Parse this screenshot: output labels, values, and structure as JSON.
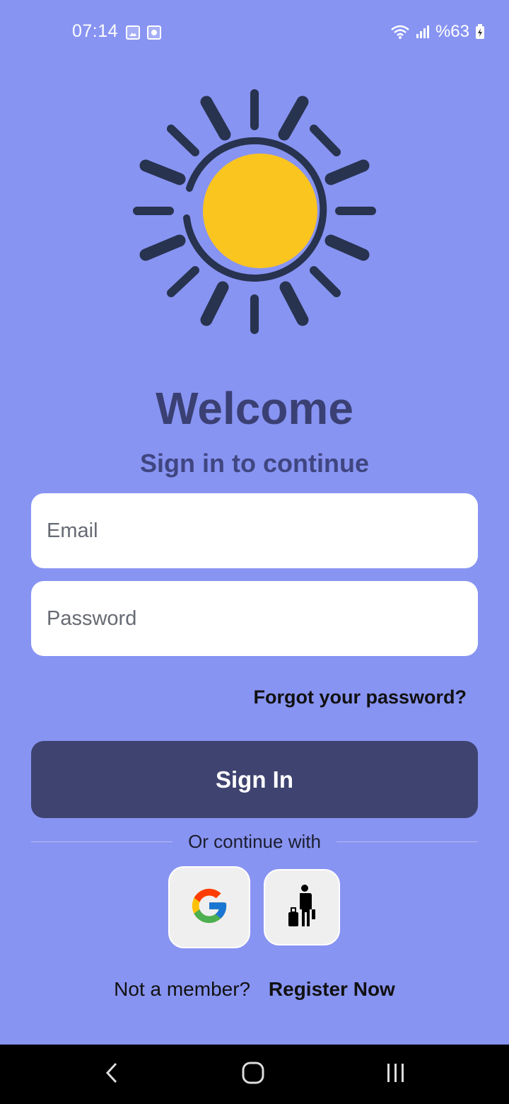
{
  "status_bar": {
    "time": "07:14",
    "battery": "%63",
    "icons": [
      "gallery-icon",
      "screen-record-icon",
      "wifi-icon",
      "signal-icon",
      "battery-icon"
    ]
  },
  "logo": {
    "icon": "sun-logo-icon",
    "colors": {
      "rays": "#27334f",
      "sun": "#fbc520"
    }
  },
  "header": {
    "title": "Welcome",
    "subtitle": "Sign in to continue"
  },
  "form": {
    "email_placeholder": "Email",
    "password_placeholder": "Password",
    "forgot_label": "Forgot your password?",
    "signin_label": "Sign In"
  },
  "social": {
    "divider_text": "Or continue with",
    "buttons": [
      {
        "name": "google-login",
        "icon": "google-icon"
      },
      {
        "name": "guest-login",
        "icon": "traveler-icon"
      }
    ]
  },
  "footer": {
    "prompt": "Not a member?",
    "register_label": "Register Now"
  },
  "colors": {
    "background": "#8894f2",
    "primary": "#3e4370",
    "title": "#3a4073"
  },
  "nav": {
    "icons": [
      "back-icon",
      "home-icon",
      "recents-icon"
    ]
  }
}
